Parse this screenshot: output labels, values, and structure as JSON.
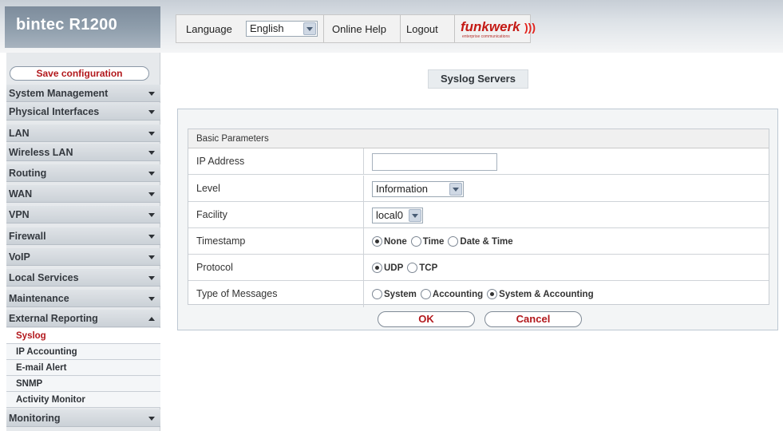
{
  "header": {
    "brand": "bintec R1200",
    "language_label": "Language",
    "language_value": "English",
    "online_help": "Online Help",
    "logout": "Logout",
    "logo_text": "funkwerk",
    "logo_sub": "enterprise communications"
  },
  "sidebar": {
    "save_label": "Save configuration",
    "items": [
      {
        "label": "System Management"
      },
      {
        "label": "Physical Interfaces"
      },
      {
        "label": "LAN"
      },
      {
        "label": "Wireless LAN"
      },
      {
        "label": "Routing"
      },
      {
        "label": "WAN"
      },
      {
        "label": "VPN"
      },
      {
        "label": "Firewall"
      },
      {
        "label": "VoIP"
      },
      {
        "label": "Local Services"
      },
      {
        "label": "Maintenance"
      },
      {
        "label": "External Reporting"
      },
      {
        "label": "Monitoring"
      }
    ],
    "subitems": [
      {
        "label": "Syslog",
        "active": true
      },
      {
        "label": "IP Accounting"
      },
      {
        "label": "E-mail Alert"
      },
      {
        "label": "SNMP"
      },
      {
        "label": "Activity Monitor"
      }
    ]
  },
  "main": {
    "page_title": "Syslog Servers",
    "section_title": "Basic Parameters",
    "fields": {
      "ip_label": "IP Address",
      "ip_value": "",
      "level_label": "Level",
      "level_value": "Information",
      "facility_label": "Facility",
      "facility_value": "local0",
      "timestamp_label": "Timestamp",
      "timestamp_options": [
        "None",
        "Time",
        "Date & Time"
      ],
      "timestamp_selected": "None",
      "protocol_label": "Protocol",
      "protocol_options": [
        "UDP",
        "TCP"
      ],
      "protocol_selected": "UDP",
      "msgtype_label": "Type of Messages",
      "msgtype_options": [
        "System",
        "Accounting",
        "System & Accounting"
      ],
      "msgtype_selected": "System & Accounting"
    },
    "ok_label": "OK",
    "cancel_label": "Cancel"
  },
  "colors": {
    "accent_red": "#b2181c",
    "sidebar_bg": "#e6e9ec"
  }
}
